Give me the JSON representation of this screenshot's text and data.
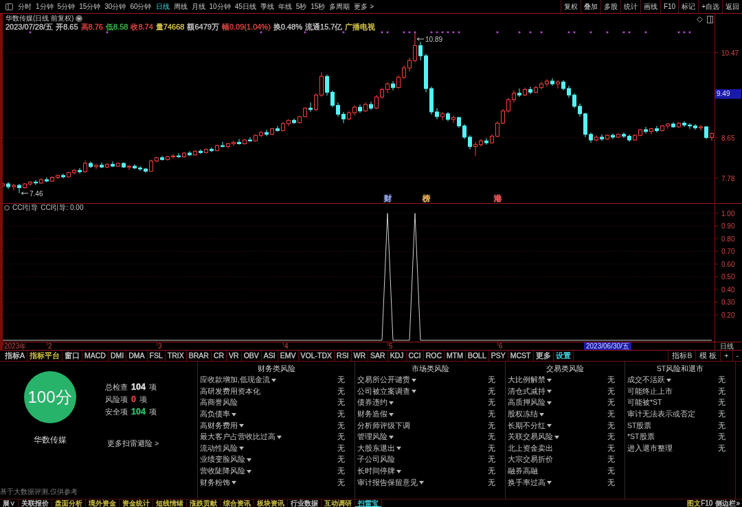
{
  "toolbar": {
    "periods": [
      {
        "label": "分时",
        "selected": false
      },
      {
        "label": "1分钟",
        "selected": false
      },
      {
        "label": "5分钟",
        "selected": false
      },
      {
        "label": "15分钟",
        "selected": false
      },
      {
        "label": "30分钟",
        "selected": false
      },
      {
        "label": "60分钟",
        "selected": false
      },
      {
        "label": "日线",
        "selected": true
      },
      {
        "label": "周线",
        "selected": false
      },
      {
        "label": "月线",
        "selected": false
      },
      {
        "label": "10分钟",
        "selected": false
      },
      {
        "label": "45日线",
        "selected": false
      },
      {
        "label": "季线",
        "selected": false
      },
      {
        "label": "年线",
        "selected": false
      },
      {
        "label": "5秒",
        "selected": false
      },
      {
        "label": "15秒",
        "selected": false
      },
      {
        "label": "多周期",
        "selected": false
      },
      {
        "label": "更多 >",
        "selected": false
      }
    ],
    "actions": [
      "复权",
      "叠加",
      "多股",
      "统计",
      "画线",
      "F10",
      "标记",
      "+自选",
      "返回"
    ]
  },
  "quote": {
    "title": "华数传媒(日线 前复权)",
    "fields": [
      {
        "text": "2023/07/28/五",
        "color": "#c8c8c8"
      },
      {
        "text": "开8.65",
        "color": "#c8c8c8"
      },
      {
        "text": "高8.76",
        "color": "#e84444"
      },
      {
        "text": "低8.58",
        "color": "#3cc048"
      },
      {
        "text": "收8.74",
        "color": "#e84444"
      },
      {
        "text": "量74668",
        "color": "#d8c848"
      },
      {
        "text": "额6479万",
        "color": "#c8c8c8"
      },
      {
        "text": "幅0.09(1.04%)",
        "color": "#e84444"
      },
      {
        "text": "换0.48%",
        "color": "#c8c8c8"
      },
      {
        "text": "流通15.7亿",
        "color": "#c8c8c8"
      },
      {
        "text": "广播电视",
        "color": "#d8c848"
      }
    ]
  },
  "price_chart": {
    "chart_data": [
      {
        "type": "candlestick",
        "ylim": [
          7.25,
          11.3
        ],
        "yticks": [
          7.78,
          8.65,
          10.47
        ],
        "grid": true,
        "annotations": [
          "10.89",
          "7.46"
        ],
        "categories": [
          null,
          null,
          null,
          null,
          null,
          null,
          null,
          null,
          null,
          null,
          null,
          null,
          null,
          null,
          null,
          null,
          null,
          null,
          null,
          null,
          null,
          null,
          null,
          null,
          null,
          null,
          null,
          null,
          null,
          null,
          null,
          null,
          null,
          null,
          null,
          null,
          null,
          null,
          null,
          null,
          null,
          null,
          null,
          null,
          null,
          null,
          null,
          null,
          null,
          null,
          null,
          null,
          null,
          null,
          null,
          null,
          null,
          null,
          null,
          null,
          null,
          null,
          null,
          null,
          null,
          null,
          null,
          null,
          null,
          null,
          null,
          null,
          null,
          null,
          null,
          null,
          null,
          null,
          null,
          null,
          null,
          null,
          null,
          null,
          null,
          null,
          null,
          null,
          null,
          null,
          null,
          null,
          null,
          null,
          null,
          null,
          null,
          null,
          null,
          null,
          null,
          null,
          null,
          null,
          null,
          null,
          null,
          null,
          null,
          null,
          null,
          null,
          null,
          null,
          null,
          null,
          null,
          null,
          null,
          null,
          null,
          null,
          null,
          null,
          null,
          null,
          null,
          null,
          null,
          null
        ],
        "ohlc": [
          [
            7.62,
            7.7,
            7.58,
            7.66
          ],
          [
            7.66,
            7.7,
            7.55,
            7.6
          ],
          [
            7.6,
            7.66,
            7.52,
            7.63
          ],
          [
            7.63,
            7.66,
            7.46,
            7.58
          ],
          [
            7.58,
            7.68,
            7.56,
            7.66
          ],
          [
            7.66,
            7.72,
            7.62,
            7.7
          ],
          [
            7.7,
            7.74,
            7.64,
            7.68
          ],
          [
            7.68,
            7.78,
            7.66,
            7.75
          ],
          [
            7.75,
            7.8,
            7.7,
            7.72
          ],
          [
            7.72,
            7.82,
            7.7,
            7.8
          ],
          [
            7.8,
            7.86,
            7.76,
            7.84
          ],
          [
            7.84,
            7.88,
            7.78,
            7.81
          ],
          [
            7.81,
            7.92,
            7.8,
            7.9
          ],
          [
            7.9,
            7.98,
            7.86,
            7.95
          ],
          [
            7.95,
            8.0,
            7.88,
            7.92
          ],
          [
            7.92,
            8.16,
            7.9,
            8.1
          ],
          [
            8.1,
            8.14,
            8.0,
            8.03
          ],
          [
            8.03,
            8.08,
            7.98,
            8.06
          ],
          [
            8.06,
            8.12,
            8.0,
            8.02
          ],
          [
            8.02,
            8.1,
            8.0,
            8.08
          ],
          [
            8.08,
            8.14,
            8.02,
            8.04
          ],
          [
            8.04,
            8.12,
            8.02,
            8.1
          ],
          [
            8.1,
            8.12,
            8.0,
            8.02
          ],
          [
            8.02,
            8.06,
            7.96,
            8.04
          ],
          [
            8.04,
            8.08,
            7.98,
            8.0
          ],
          [
            8.0,
            8.04,
            7.94,
            7.98
          ],
          [
            7.98,
            8.0,
            7.9,
            7.93
          ],
          [
            7.93,
            8.18,
            7.92,
            8.15
          ],
          [
            8.15,
            8.24,
            8.12,
            8.22
          ],
          [
            8.22,
            8.26,
            8.16,
            8.18
          ],
          [
            8.18,
            8.26,
            8.16,
            8.24
          ],
          [
            8.24,
            8.3,
            8.2,
            8.26
          ],
          [
            8.26,
            8.32,
            8.22,
            8.24
          ],
          [
            8.24,
            8.34,
            8.22,
            8.32
          ],
          [
            8.32,
            8.36,
            8.26,
            8.28
          ],
          [
            8.28,
            8.38,
            8.26,
            8.36
          ],
          [
            8.36,
            8.4,
            8.3,
            8.33
          ],
          [
            8.33,
            8.42,
            8.31,
            8.4
          ],
          [
            8.4,
            8.44,
            8.34,
            8.37
          ],
          [
            8.37,
            8.5,
            8.36,
            8.48
          ],
          [
            8.48,
            8.56,
            8.44,
            8.46
          ],
          [
            8.46,
            8.54,
            8.42,
            8.52
          ],
          [
            8.52,
            8.58,
            8.48,
            8.55
          ],
          [
            8.55,
            8.62,
            8.5,
            8.52
          ],
          [
            8.52,
            8.62,
            8.5,
            8.6
          ],
          [
            8.6,
            8.66,
            8.56,
            8.58
          ],
          [
            8.58,
            8.72,
            8.56,
            8.7
          ],
          [
            8.7,
            8.8,
            8.66,
            8.76
          ],
          [
            8.76,
            8.82,
            8.68,
            8.72
          ],
          [
            8.72,
            8.86,
            8.7,
            8.84
          ],
          [
            8.84,
            8.9,
            8.78,
            8.8
          ],
          [
            8.8,
            8.98,
            8.78,
            8.95
          ],
          [
            8.95,
            9.04,
            8.9,
            9.02
          ],
          [
            9.02,
            9.06,
            8.94,
            8.97
          ],
          [
            8.97,
            9.12,
            8.95,
            9.1
          ],
          [
            9.1,
            9.3,
            9.08,
            9.28
          ],
          [
            9.28,
            9.4,
            9.2,
            9.25
          ],
          [
            9.25,
            9.6,
            9.22,
            9.56
          ],
          [
            9.56,
            10.05,
            9.52,
            9.96
          ],
          [
            9.96,
            10.0,
            9.55,
            9.62
          ],
          [
            9.62,
            9.66,
            9.3,
            9.34
          ],
          [
            9.34,
            9.4,
            9.1,
            9.15
          ],
          [
            9.15,
            9.2,
            8.96,
            9.05
          ],
          [
            9.05,
            9.22,
            9.02,
            9.18
          ],
          [
            9.18,
            9.34,
            9.12,
            9.3
          ],
          [
            9.3,
            9.36,
            9.18,
            9.22
          ],
          [
            9.22,
            9.4,
            9.2,
            9.36
          ],
          [
            9.36,
            9.42,
            9.24,
            9.28
          ],
          [
            9.28,
            9.56,
            9.26,
            9.52
          ],
          [
            9.52,
            9.72,
            9.48,
            9.68
          ],
          [
            9.68,
            9.84,
            9.6,
            9.8
          ],
          [
            9.8,
            9.86,
            9.66,
            9.72
          ],
          [
            9.72,
            9.98,
            9.7,
            9.94
          ],
          [
            9.94,
            10.2,
            9.9,
            10.14
          ],
          [
            10.14,
            10.36,
            10.06,
            10.3
          ],
          [
            10.3,
            10.89,
            10.26,
            10.62
          ],
          [
            10.62,
            10.7,
            10.3,
            10.4
          ],
          [
            10.4,
            10.44,
            9.62,
            9.7
          ],
          [
            9.7,
            9.74,
            9.14,
            9.2
          ],
          [
            9.2,
            9.28,
            9.04,
            9.1
          ],
          [
            9.1,
            9.2,
            9.02,
            9.16
          ],
          [
            9.16,
            9.2,
            9.0,
            9.04
          ],
          [
            9.04,
            9.12,
            8.96,
            9.08
          ],
          [
            9.08,
            9.1,
            8.86,
            8.9
          ],
          [
            8.9,
            8.94,
            8.62,
            8.66
          ],
          [
            8.66,
            8.7,
            8.4,
            8.46
          ],
          [
            8.46,
            8.56,
            8.26,
            8.5
          ],
          [
            8.5,
            8.62,
            8.46,
            8.58
          ],
          [
            8.58,
            8.64,
            8.5,
            8.54
          ],
          [
            8.54,
            8.72,
            8.52,
            8.68
          ],
          [
            8.68,
            9.0,
            8.66,
            8.96
          ],
          [
            8.96,
            9.26,
            8.94,
            9.22
          ],
          [
            9.22,
            9.5,
            9.18,
            9.46
          ],
          [
            9.46,
            9.66,
            9.4,
            9.6
          ],
          [
            9.6,
            9.7,
            9.52,
            9.56
          ],
          [
            9.56,
            9.72,
            9.54,
            9.68
          ],
          [
            9.68,
            9.74,
            9.58,
            9.62
          ],
          [
            9.62,
            9.76,
            9.6,
            9.72
          ],
          [
            9.72,
            9.84,
            9.68,
            9.8
          ],
          [
            9.8,
            9.9,
            9.74,
            9.86
          ],
          [
            9.86,
            9.92,
            9.76,
            9.8
          ],
          [
            9.8,
            9.88,
            9.7,
            9.84
          ],
          [
            9.84,
            9.88,
            9.66,
            9.7
          ],
          [
            9.7,
            9.76,
            9.5,
            9.56
          ],
          [
            9.56,
            9.6,
            9.28,
            9.32
          ],
          [
            9.32,
            9.38,
            9.1,
            9.16
          ],
          [
            9.16,
            9.18,
            8.66,
            8.72
          ],
          [
            8.72,
            8.76,
            8.54,
            8.6
          ],
          [
            8.6,
            8.7,
            8.56,
            8.66
          ],
          [
            8.66,
            8.72,
            8.58,
            8.62
          ],
          [
            8.62,
            8.72,
            8.6,
            8.7
          ],
          [
            8.7,
            8.74,
            8.62,
            8.66
          ],
          [
            8.66,
            8.74,
            8.64,
            8.72
          ],
          [
            8.72,
            8.76,
            8.64,
            8.68
          ],
          [
            8.68,
            8.72,
            8.56,
            8.6
          ],
          [
            8.6,
            8.72,
            8.58,
            8.7
          ],
          [
            8.7,
            8.84,
            8.68,
            8.82
          ],
          [
            8.82,
            8.88,
            8.74,
            8.78
          ],
          [
            8.78,
            8.86,
            8.72,
            8.84
          ],
          [
            8.84,
            8.9,
            8.76,
            8.8
          ],
          [
            8.8,
            8.92,
            8.78,
            8.9
          ],
          [
            8.9,
            8.96,
            8.84,
            8.94
          ],
          [
            8.94,
            8.98,
            8.86,
            8.88
          ],
          [
            8.88,
            8.98,
            8.86,
            8.96
          ],
          [
            8.96,
            9.0,
            8.88,
            8.92
          ],
          [
            8.92,
            8.96,
            8.84,
            8.9
          ],
          [
            8.9,
            8.94,
            8.82,
            8.86
          ],
          [
            8.86,
            8.92,
            8.8,
            8.88
          ],
          [
            8.88,
            8.9,
            8.62,
            8.65
          ],
          [
            8.65,
            8.76,
            8.58,
            8.74
          ]
        ]
      }
    ],
    "events": [
      {
        "label": "财",
        "color": "#8a9ad8"
      },
      {
        "label": "榜",
        "color": "#d8a050"
      },
      {
        "label": "港",
        "color": "#e05050"
      }
    ],
    "crosshair_price": "9.49"
  },
  "cci_chart": {
    "title": "CCI引导",
    "reading": "CCI引导: 0.00",
    "chart_data": [
      {
        "type": "line",
        "color": "#d0d0d0",
        "ylim": [
          0,
          1.08
        ],
        "grid": true,
        "yticks": [
          {
            "value": 0.2,
            "label": "0.20"
          },
          {
            "value": 0.3,
            "label": "0.30"
          },
          {
            "value": 0.4,
            "label": "0.40"
          },
          {
            "value": 0.5,
            "label": "0.50"
          },
          {
            "value": 0.6,
            "label": "0.60"
          },
          {
            "value": 0.7,
            "label": "0.70"
          },
          {
            "value": 0.8,
            "label": "0.80"
          },
          {
            "value": 0.9,
            "label": "0.90"
          },
          {
            "value": 1.0,
            "label": "1.00"
          }
        ],
        "categories": [
          null,
          null,
          null,
          null,
          null,
          null,
          null,
          null,
          null,
          null,
          null,
          null,
          null,
          null,
          null,
          null,
          null,
          null,
          null,
          null,
          null,
          null,
          null,
          null,
          null,
          null,
          null,
          null,
          null,
          null,
          null,
          null,
          null,
          null,
          null,
          null,
          null,
          null,
          null,
          null,
          null,
          null,
          null,
          null,
          null,
          null,
          null,
          null,
          null,
          null,
          null,
          null,
          null,
          null,
          null,
          null,
          null,
          null,
          null,
          null,
          null,
          null,
          null,
          null,
          null,
          null,
          null,
          null,
          null,
          null,
          null,
          null,
          null,
          null,
          null,
          null,
          null,
          null,
          null,
          null,
          null,
          null,
          null,
          null,
          null,
          null,
          null,
          null,
          null,
          null,
          null,
          null,
          null,
          null,
          null,
          null,
          null,
          null,
          null,
          null,
          null,
          null,
          null,
          null,
          null,
          null,
          null,
          null,
          null,
          null,
          null,
          null,
          null,
          null,
          null,
          null,
          null,
          null,
          null,
          null,
          null,
          null,
          null,
          null,
          null,
          null,
          null,
          null,
          null,
          null
        ],
        "values": [
          0,
          0,
          0,
          0,
          0,
          0,
          0,
          0,
          0,
          0,
          0,
          0,
          0,
          0,
          0,
          0,
          0,
          0,
          0,
          0,
          0,
          0,
          0,
          0,
          0,
          0,
          0,
          0,
          0,
          0,
          0,
          0,
          0,
          0,
          0,
          0,
          0,
          0,
          0,
          0,
          0,
          0,
          0,
          0,
          0,
          0,
          0,
          0,
          0,
          0,
          0,
          0,
          0,
          0,
          0,
          0,
          0,
          0,
          0,
          0,
          0,
          0,
          0,
          0,
          0,
          0,
          0,
          0,
          0,
          0,
          1,
          0,
          0,
          0,
          0,
          1,
          0,
          0,
          0,
          0,
          0,
          0,
          0,
          0,
          0,
          0,
          0,
          0,
          0,
          0,
          0,
          0,
          0,
          0,
          0,
          0,
          0,
          0,
          0,
          0,
          0,
          0,
          0,
          0,
          0,
          0,
          0,
          0,
          0,
          0,
          0,
          0,
          0,
          0,
          0,
          0,
          0,
          0,
          0,
          0,
          0,
          0,
          0,
          0,
          0,
          0,
          0,
          0,
          0,
          0
        ]
      }
    ]
  },
  "time_axis": {
    "labels": [
      "2023年",
      "2",
      "3",
      "4",
      "5",
      "6"
    ],
    "crosshair_date": "2023/06/30/五",
    "period": "日线"
  },
  "indicator_tabs": {
    "left": [
      {
        "label": "指标A",
        "color": "#c8c8c8"
      },
      {
        "label": "指标平台",
        "color": "#d8c848"
      },
      {
        "label": "窗口",
        "color": "#c8c8c8"
      },
      {
        "label": "MACD",
        "color": "#c8c8c8"
      },
      {
        "label": "DMI",
        "color": "#c8c8c8"
      },
      {
        "label": "DMA",
        "color": "#c8c8c8"
      },
      {
        "label": "FSL",
        "color": "#c8c8c8"
      },
      {
        "label": "TRIX",
        "color": "#c8c8c8"
      },
      {
        "label": "BRAR",
        "color": "#c8c8c8"
      },
      {
        "label": "CR",
        "color": "#c8c8c8"
      },
      {
        "label": "VR",
        "color": "#c8c8c8"
      },
      {
        "label": "OBV",
        "color": "#c8c8c8"
      },
      {
        "label": "ASI",
        "color": "#c8c8c8"
      },
      {
        "label": "EMV",
        "color": "#c8c8c8"
      },
      {
        "label": "VOL-TDX",
        "color": "#c8c8c8"
      },
      {
        "label": "RSI",
        "color": "#c8c8c8"
      },
      {
        "label": "WR",
        "color": "#c8c8c8"
      },
      {
        "label": "SAR",
        "color": "#c8c8c8"
      },
      {
        "label": "KDJ",
        "color": "#c8c8c8"
      },
      {
        "label": "CCI",
        "color": "#c8c8c8"
      },
      {
        "label": "ROC",
        "color": "#c8c8c8"
      },
      {
        "label": "MTM",
        "color": "#c8c8c8"
      },
      {
        "label": "BOLL",
        "color": "#c8c8c8"
      },
      {
        "label": "PSY",
        "color": "#c8c8c8"
      },
      {
        "label": "MCST",
        "color": "#c8c8c8"
      },
      {
        "label": "更多",
        "color": "#c8c8c8"
      },
      {
        "label": "设置",
        "color": "#3fd6e0"
      }
    ],
    "right": [
      "指标B",
      "模 板",
      "+",
      "-"
    ]
  },
  "risk_scan": {
    "score": "100分",
    "stock": "华数传媒",
    "stats": [
      {
        "label": "总检查",
        "value": "104",
        "unit": "项",
        "color": "#e0e0e0"
      },
      {
        "label": "风险项",
        "value": "0",
        "unit": "项",
        "color": "#e04040"
      },
      {
        "label": "安全项",
        "value": "104",
        "unit": "项",
        "color": "#2fbf6a"
      }
    ],
    "more_link": "更多扫雷避险 >",
    "disclaimer": "基于大数据评测,仅供参考",
    "categories": [
      {
        "title": "财务类风险",
        "items": [
          {
            "label": "应收款增加,低现金流",
            "dropdown": true,
            "status": "无"
          },
          {
            "label": "高研发费用资本化",
            "dropdown": false,
            "status": "无"
          },
          {
            "label": "高商誉风险",
            "dropdown": false,
            "status": "无"
          },
          {
            "label": "高负债率",
            "dropdown": true,
            "status": "无"
          },
          {
            "label": "高财务费用",
            "dropdown": true,
            "status": "无"
          },
          {
            "label": "最大客户占营收比过高",
            "dropdown": true,
            "status": "无"
          },
          {
            "label": "流动性风险",
            "dropdown": true,
            "status": "无"
          },
          {
            "label": "业绩变脸风险",
            "dropdown": true,
            "status": "无"
          },
          {
            "label": "营收陡降风险",
            "dropdown": true,
            "status": "无"
          },
          {
            "label": "财务粉饰",
            "dropdown": true,
            "status": "无"
          }
        ]
      },
      {
        "title": "市场类风险",
        "items": [
          {
            "label": "交易所公开谴责",
            "dropdown": true,
            "status": "无"
          },
          {
            "label": "公司被立案调查",
            "dropdown": true,
            "status": "无"
          },
          {
            "label": "债券违约",
            "dropdown": true,
            "status": "无"
          },
          {
            "label": "财务造假",
            "dropdown": true,
            "status": "无"
          },
          {
            "label": "分析师评级下调",
            "dropdown": false,
            "status": "无"
          },
          {
            "label": "管理风险",
            "dropdown": true,
            "status": "无"
          },
          {
            "label": "大股东退出",
            "dropdown": true,
            "status": "无"
          },
          {
            "label": "子公司风险",
            "dropdown": false,
            "status": "无"
          },
          {
            "label": "长时间停牌",
            "dropdown": true,
            "status": "无"
          },
          {
            "label": "审计报告保留意见",
            "dropdown": true,
            "status": "无"
          }
        ]
      },
      {
        "title": "交易类风险",
        "items": [
          {
            "label": "大比例解禁",
            "dropdown": true,
            "status": "无"
          },
          {
            "label": "清仓式减持",
            "dropdown": true,
            "status": "无"
          },
          {
            "label": "高质押风险",
            "dropdown": true,
            "status": "无"
          },
          {
            "label": "股权冻结",
            "dropdown": true,
            "status": "无"
          },
          {
            "label": "长期不分红",
            "dropdown": true,
            "status": "无"
          },
          {
            "label": "关联交易风险",
            "dropdown": true,
            "status": "无"
          },
          {
            "label": "北上资金卖出",
            "dropdown": false,
            "status": "无"
          },
          {
            "label": "大宗交易折价",
            "dropdown": false,
            "status": "无"
          },
          {
            "label": "融券高融",
            "dropdown": false,
            "status": "无"
          },
          {
            "label": "换手率过高",
            "dropdown": true,
            "status": "无"
          }
        ]
      },
      {
        "title": "ST风险和退市",
        "items": [
          {
            "label": "成交不活跃",
            "dropdown": true,
            "status": "无"
          },
          {
            "label": "可能终止上市",
            "dropdown": false,
            "status": "无"
          },
          {
            "label": "可能被*ST",
            "dropdown": false,
            "status": "无"
          },
          {
            "label": "审计无法表示或否定",
            "dropdown": false,
            "status": "无"
          },
          {
            "label": "ST股票",
            "dropdown": false,
            "status": "无"
          },
          {
            "label": "*ST股票",
            "dropdown": false,
            "status": "无"
          },
          {
            "label": "进入退市整理",
            "dropdown": false,
            "status": "无"
          }
        ]
      }
    ]
  },
  "bottom_tabs": {
    "items": [
      {
        "label": "展∨",
        "color": "#c8c8c8",
        "selected": false
      },
      {
        "label": "关联报价",
        "color": "#c8c8c8",
        "selected": false
      },
      {
        "label": "盘面分析",
        "color": "#d8c848",
        "selected": false
      },
      {
        "label": "境外资金",
        "color": "#d8c848",
        "selected": false
      },
      {
        "label": "资金统计",
        "color": "#d8c848",
        "selected": false
      },
      {
        "label": "短线情绪",
        "color": "#d8c848",
        "selected": false
      },
      {
        "label": "涨跌贡献",
        "color": "#d8c848",
        "selected": false
      },
      {
        "label": "综合资讯",
        "color": "#d8c848",
        "selected": false
      },
      {
        "label": "板块资讯",
        "color": "#d8c848",
        "selected": false
      },
      {
        "label": "行业数据",
        "color": "#c8c8c8",
        "selected": false
      },
      {
        "label": "互动调研",
        "color": "#d8c848",
        "selected": false
      },
      {
        "label": "扫雷宝",
        "color": "#3fd6e0",
        "selected": true
      }
    ],
    "right": [
      {
        "text": "图文",
        "color": "#d8c848"
      },
      {
        "text": "F10",
        "color": "#c8c8c8"
      },
      {
        "text": "侧边栏»",
        "color": "#c8c8c8"
      }
    ]
  }
}
